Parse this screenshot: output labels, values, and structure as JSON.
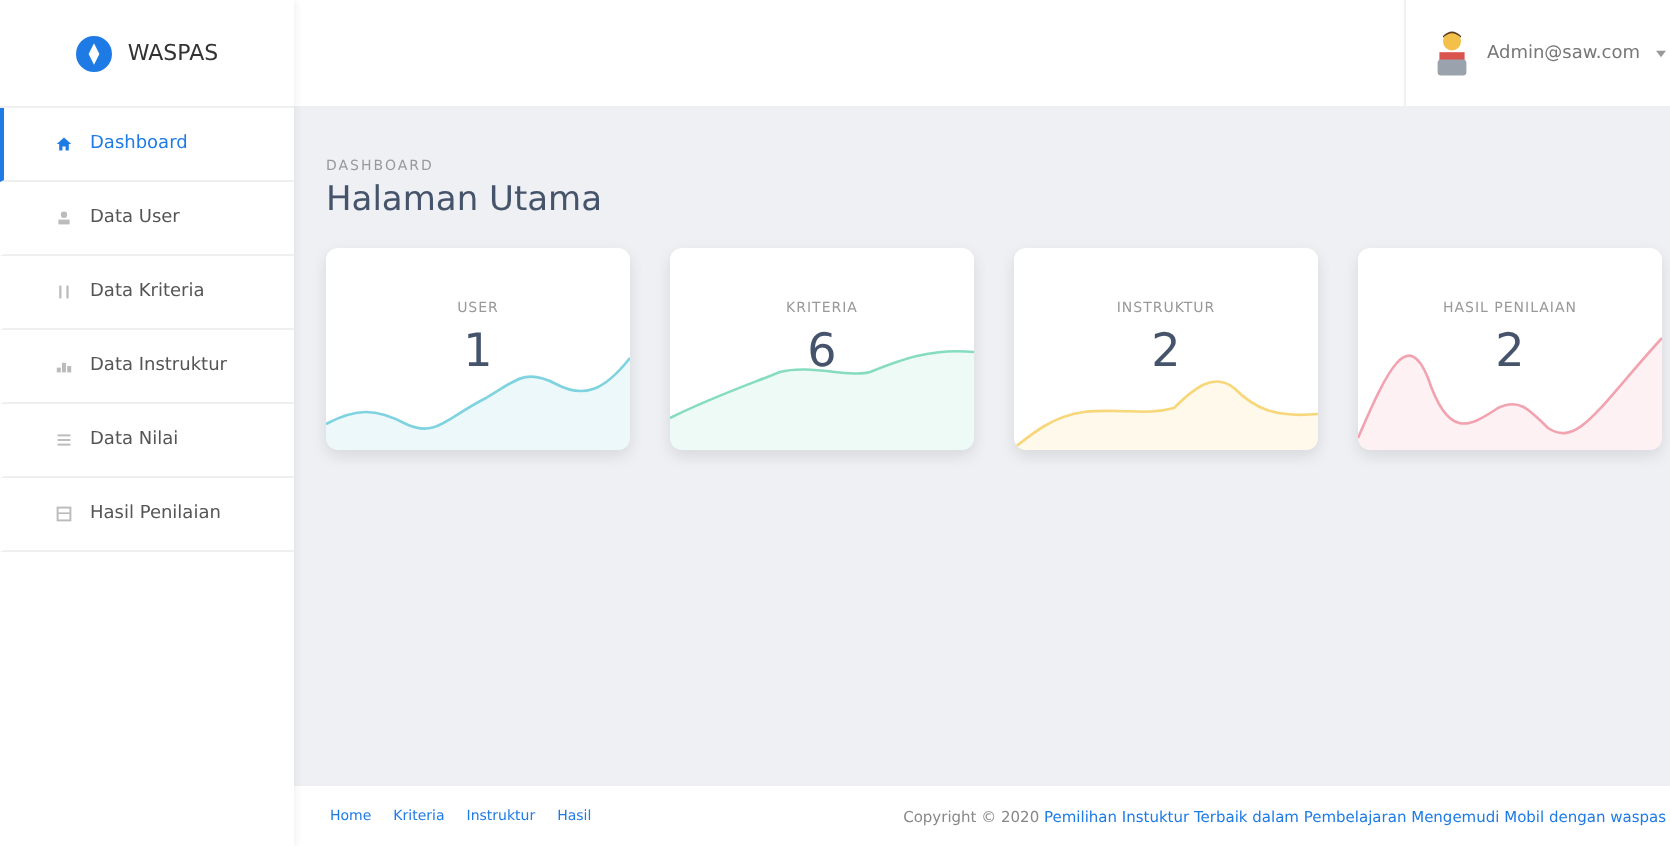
{
  "brand": "WASPAS",
  "sidebar": {
    "items": [
      {
        "label": "Dashboard",
        "selected": true
      },
      {
        "label": "Data User",
        "selected": false
      },
      {
        "label": "Data Kriteria",
        "selected": false
      },
      {
        "label": "Data Instruktur",
        "selected": false
      },
      {
        "label": "Data Nilai",
        "selected": false
      },
      {
        "label": "Hasil Penilaian",
        "selected": false
      }
    ]
  },
  "user": {
    "name": "Admin@saw.com"
  },
  "breadcrumb": "DASHBOARD",
  "title": "Halaman Utama",
  "cards": [
    {
      "label": "USER",
      "value": "1",
      "color": "#7fd3e0"
    },
    {
      "label": "KRITERIA",
      "value": "6",
      "color": "#86dcc0"
    },
    {
      "label": "INSTRUKTUR",
      "value": "2",
      "color": "#f7d77a"
    },
    {
      "label": "HASIL PENILAIAN",
      "value": "2",
      "color": "#f2a3b0"
    }
  ],
  "footer": {
    "links": [
      "Home",
      "Kriteria",
      "Instruktur",
      "Hasil"
    ],
    "copyright": "Copyright © 2020",
    "project_link": "Pemilihan Instuktur Terbaik dalam Pembelajaran Mengemudi Mobil dengan waspas"
  }
}
